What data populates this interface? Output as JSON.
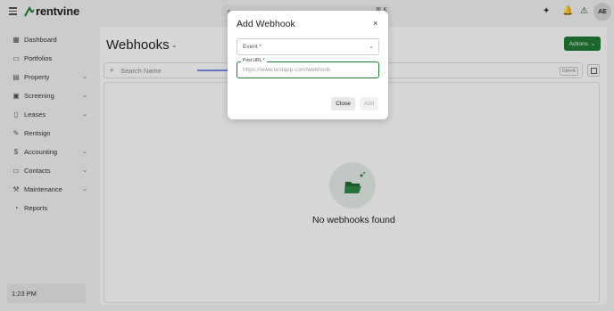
{
  "app": {
    "brand": "rentvine"
  },
  "topbar": {
    "search_shortcut": "⌘ K",
    "avatar_initials": "AE"
  },
  "sidebar": {
    "items": [
      {
        "label": "Dashboard",
        "icon": "grid-icon",
        "has_chevron": false
      },
      {
        "label": "Portfolios",
        "icon": "folder-icon",
        "has_chevron": false
      },
      {
        "label": "Property",
        "icon": "building-icon",
        "has_chevron": true
      },
      {
        "label": "Screening",
        "icon": "screening-icon",
        "has_chevron": true
      },
      {
        "label": "Leases",
        "icon": "document-icon",
        "has_chevron": true
      },
      {
        "label": "Rentsign",
        "icon": "pen-icon",
        "has_chevron": false
      },
      {
        "label": "Accounting",
        "icon": "dollar-icon",
        "has_chevron": true
      },
      {
        "label": "Contacts",
        "icon": "contacts-icon",
        "has_chevron": true
      },
      {
        "label": "Maintenance",
        "icon": "wrench-icon",
        "has_chevron": true
      },
      {
        "label": "Reports",
        "icon": "reports-icon",
        "has_chevron": false
      }
    ],
    "time": "1:23 PM"
  },
  "main": {
    "title": "Webhooks",
    "actions_label": "Actions",
    "search_placeholder": "Search Name",
    "search_shortcut": "Ctrl+K",
    "empty_text": "No webhooks found"
  },
  "modal": {
    "title": "Add Webhook",
    "event_label": "Event *",
    "url_label": "Post URL *",
    "url_placeholder": "https://www.testapp.com/webhook",
    "close_label": "Close",
    "add_label": "Add"
  },
  "colors": {
    "accent": "#1f7a34",
    "annotation": "#1f3fbf"
  }
}
